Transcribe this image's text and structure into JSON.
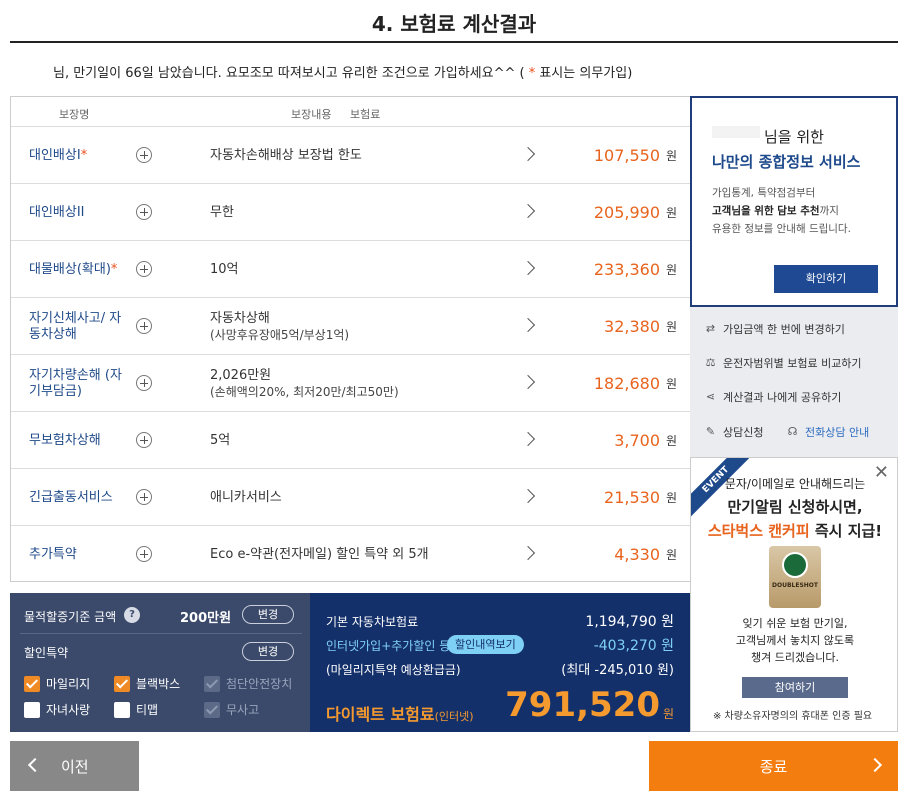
{
  "page": {
    "title": "4. 보험료 계산결과",
    "notice_main": "님, 만기일이 66일 남았습니다. 요모조모 따져보시고 유리한 조건으로 가입하세요^^ ( ",
    "notice_star": "*",
    "notice_end": " 표시는 의무가입)"
  },
  "table": {
    "headers": [
      "보장명",
      "보장내용",
      "보험료"
    ],
    "currency": "원",
    "rows": [
      {
        "name": "대인배상I",
        "required": "*",
        "detail": "자동차손해배상 보장법 한도",
        "sub": "",
        "premium": "107,550"
      },
      {
        "name": "대인배상II",
        "required": "",
        "detail": "무한",
        "sub": "",
        "premium": "205,990"
      },
      {
        "name": "대물배상(확대)",
        "required": "*",
        "detail": "10억",
        "sub": "",
        "premium": "233,360"
      },
      {
        "name": "자기신체사고/ 자동차상해",
        "required": "",
        "detail": "자동차상해",
        "sub": "(사망후유장애5억/부상1억)",
        "premium": "32,380"
      },
      {
        "name": "자기차량손해 (자기부담금)",
        "required": "",
        "detail": "2,026만원",
        "sub": "(손해액의20%, 최저20만/최고50만)",
        "premium": "182,680"
      },
      {
        "name": "무보험차상해",
        "required": "",
        "detail": "5억",
        "sub": "",
        "premium": "3,700"
      },
      {
        "name": "긴급출동서비스",
        "required": "",
        "detail": "애니카서비스",
        "sub": "",
        "premium": "21,530"
      },
      {
        "name": "추가특약",
        "required": "",
        "detail": "Eco e-약관(전자메일) 할인 특약 외 5개",
        "sub": "",
        "premium": "4,330"
      }
    ]
  },
  "promo": {
    "line1": "님을 위한",
    "line2": "나만의 종합정보 서비스",
    "desc1": "가입통계, 특약점검부터",
    "desc2_bold": "고객님을 위한 담보 추천",
    "desc2_rest": "까지",
    "desc3": "유용한 정보를 안내해 드립니다.",
    "button": "확인하기"
  },
  "links": {
    "change": "가입금액 한 번에 변경하기",
    "compare": "운전자범위별 보험료 비교하기",
    "share": "계산결과 나에게 공유하기",
    "consult": "상담신청",
    "phone": "전화상담 안내"
  },
  "event": {
    "ribbon": "EVENT",
    "close": "✕",
    "line1": "문자/이메일로 안내해드리는",
    "line2": "만기알림 신청하시면,",
    "line3_orange": "스타벅스 캔커피",
    "line3_rest": " 즉시 지급!",
    "can_text": "DOUBLESHOT",
    "msg1": "잊기 쉬운 보험 만기일,",
    "msg2": "고객님께서 놓치지 않도록",
    "msg3": "챙겨 드리겠습니다.",
    "button": "참여하기",
    "note": "※ 차량소유자명의의 휴대폰 인증 필요"
  },
  "discount": {
    "base_label": "물적할증기준 금액",
    "help": "?",
    "base_amount": "200만원",
    "change": "변경",
    "special_label": "할인특약",
    "options": [
      {
        "label": "마일리지",
        "state": "checked"
      },
      {
        "label": "블랙박스",
        "state": "checked"
      },
      {
        "label": "첨단안전장치",
        "state": "disabled"
      },
      {
        "label": "자녀사랑",
        "state": "unchecked"
      },
      {
        "label": "티맵",
        "state": "unchecked"
      },
      {
        "label": "무사고",
        "state": "disabled"
      }
    ]
  },
  "total": {
    "base_label": "기본 자동차보험료",
    "base_value": "1,194,790 원",
    "discount_label": "인터넷가입+추가할인 등",
    "discount_button": "할인내역보기",
    "discount_value": "-403,270 원",
    "mileage_label": "(마일리지특약 예상환급금)",
    "mileage_value": "(최대 -245,010 원)",
    "direct_label": "다이렉트 보험료",
    "direct_sub": "(인터넷)",
    "direct_value": "791,520",
    "won": "원"
  },
  "nav": {
    "prev": "이전",
    "end": "종료"
  },
  "colors": {
    "accent_orange": "#e8641e",
    "navy": "#14306b",
    "link_blue": "#1f4a8a"
  }
}
